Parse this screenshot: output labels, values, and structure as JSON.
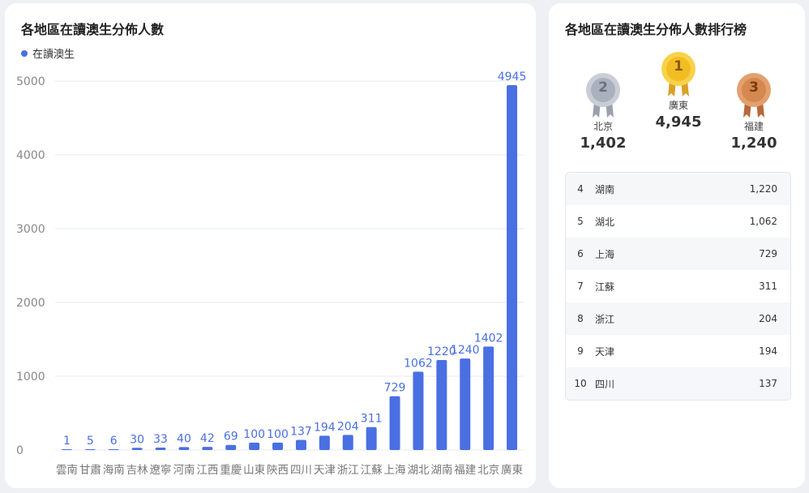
{
  "left_card": {
    "title": "各地區在讀澳生分佈人數",
    "legend_label": "在讀澳生"
  },
  "right_card": {
    "title": "各地區在讀澳生分佈人數排行榜"
  },
  "podium": [
    {
      "rank": "2",
      "name": "北京",
      "value": "1,402",
      "medal": "silver"
    },
    {
      "rank": "1",
      "name": "廣東",
      "value": "4,945",
      "medal": "gold"
    },
    {
      "rank": "3",
      "name": "福建",
      "value": "1,240",
      "medal": "bronze"
    }
  ],
  "ranking": [
    {
      "no": "4",
      "name": "湖南",
      "value": "1,220"
    },
    {
      "no": "5",
      "name": "湖北",
      "value": "1,062"
    },
    {
      "no": "6",
      "name": "上海",
      "value": "729"
    },
    {
      "no": "7",
      "name": "江蘇",
      "value": "311"
    },
    {
      "no": "8",
      "name": "浙江",
      "value": "204"
    },
    {
      "no": "9",
      "name": "天津",
      "value": "194"
    },
    {
      "no": "10",
      "name": "四川",
      "value": "137"
    }
  ],
  "colors": {
    "bar": "#4a6fe3",
    "gold": "#f2c230",
    "silver": "#b9bfc9",
    "bronze": "#d68a55"
  },
  "chart_data": {
    "type": "bar",
    "title": "各地區在讀澳生分佈人數",
    "categories": [
      "雲南",
      "甘肅",
      "海南",
      "吉林",
      "遼寧",
      "河南",
      "江西",
      "重慶",
      "山東",
      "陝西",
      "四川",
      "天津",
      "浙江",
      "江蘇",
      "上海",
      "湖北",
      "湖南",
      "福建",
      "北京",
      "廣東"
    ],
    "series": [
      {
        "name": "在讀澳生",
        "values": [
          1,
          5,
          6,
          30,
          33,
          40,
          42,
          69,
          100,
          100,
          137,
          194,
          204,
          311,
          729,
          1062,
          1220,
          1240,
          1402,
          4945
        ]
      }
    ],
    "ylim": [
      0,
      5000
    ],
    "yticks": [
      0,
      1000,
      2000,
      3000,
      4000,
      5000
    ],
    "grid": true,
    "legend_position": "top-left",
    "xlabel": "",
    "ylabel": ""
  }
}
